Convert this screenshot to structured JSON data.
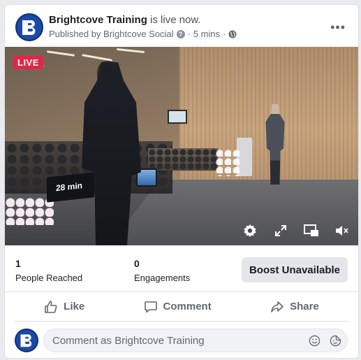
{
  "post": {
    "page_name": "Brightcove Training",
    "status_text": " is live now.",
    "published_by": "Published by Brightcove Social",
    "help_glyph": "?",
    "separator": "·",
    "time_ago": "5 mins",
    "more_glyph": "•••"
  },
  "video": {
    "live_label": "LIVE",
    "timer_sign_text": "28 min"
  },
  "stats": {
    "reached_count": "1",
    "reached_label": "People Reached",
    "engagements_count": "0",
    "engagements_label": "Engagements",
    "boost_label": "Boost Unavailable"
  },
  "actions": {
    "like_label": "Like",
    "comment_label": "Comment",
    "share_label": "Share"
  },
  "comment": {
    "placeholder": "Comment as Brightcove Training"
  },
  "colors": {
    "brand_blue": "#1b4aa8",
    "live_red": "#e42645"
  },
  "icons": [
    "brightcove-logo-icon",
    "help-icon",
    "globe-icon",
    "more-icon",
    "settings-icon",
    "fullscreen-icon",
    "pip-icon",
    "mute-icon",
    "like-icon",
    "comment-icon",
    "share-icon",
    "emoji-icon",
    "sticker-icon"
  ]
}
